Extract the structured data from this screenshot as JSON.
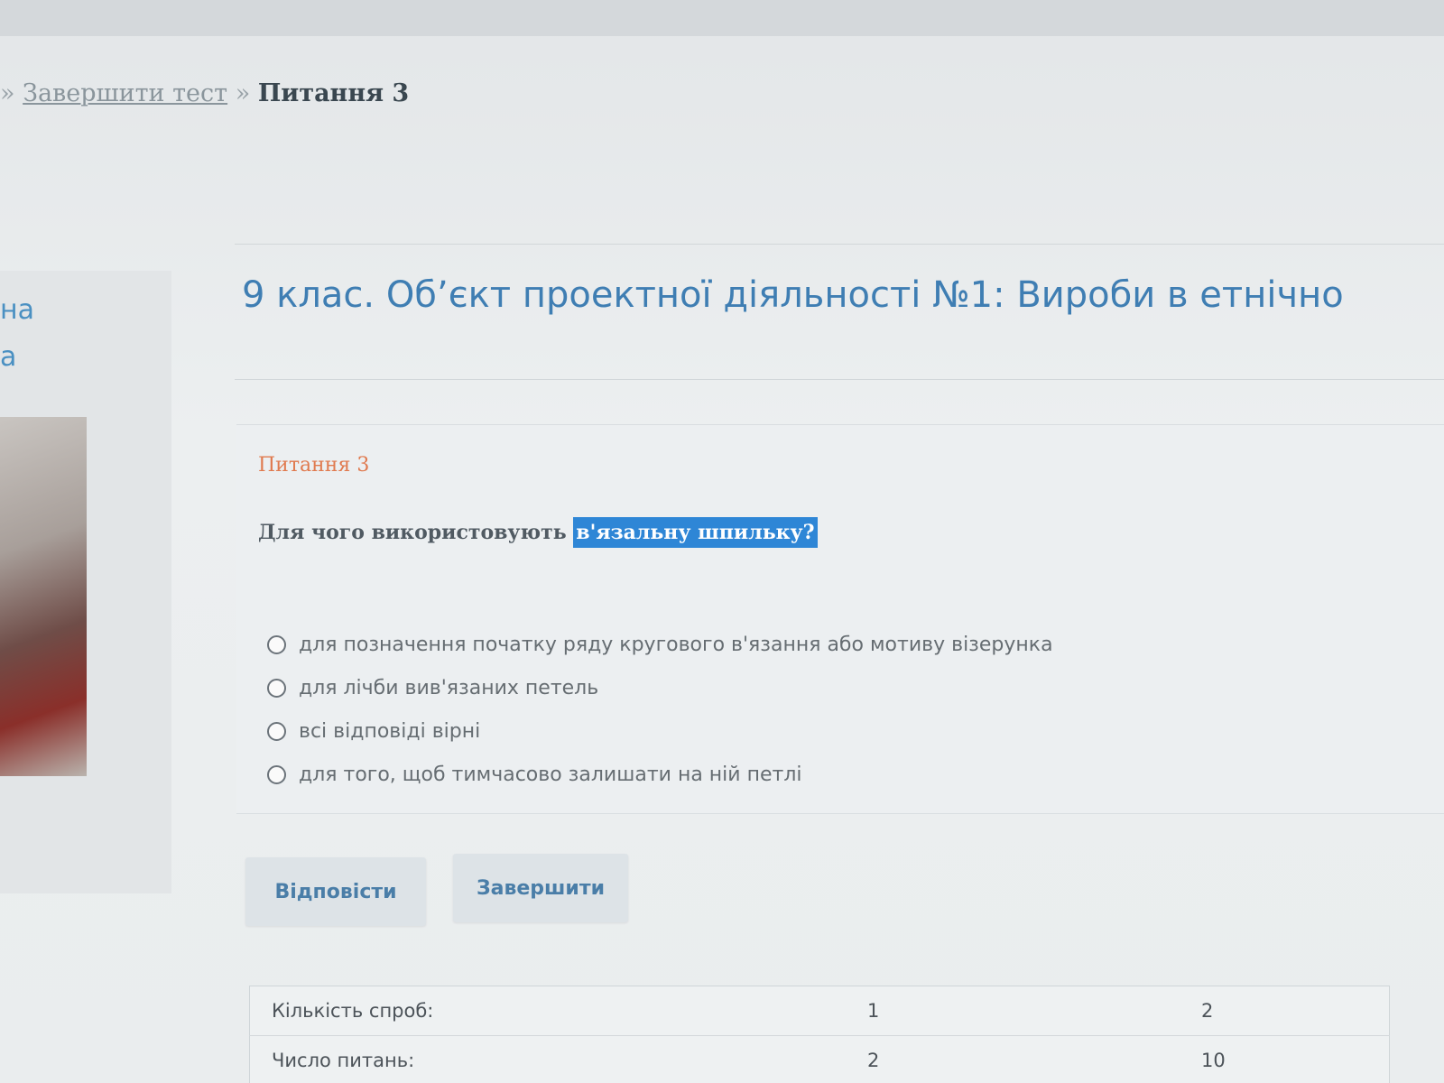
{
  "breadcrumb": {
    "separator": "»",
    "link": "Завершити тест",
    "current": "Питання 3"
  },
  "left_fragments": {
    "line1": "на",
    "line2": "а"
  },
  "page_title": "9 клас. Об’єкт проектної діяльності №1: Вироби в етнічно",
  "question": {
    "label": "Питання 3",
    "text_prefix": "Для чого використовують ",
    "text_highlighted": "в'язальну шпильку?",
    "options": [
      "для позначення початку ряду кругового в'язання або мотиву візерунка",
      "для лічби вив'язаних петель",
      "всі відповіді вірні",
      "для того, щоб тимчасово залишати на ній петлі"
    ]
  },
  "buttons": {
    "answer": "Відповісти",
    "finish": "Завершити"
  },
  "stats": {
    "rows": [
      {
        "label": "Кількість спроб:",
        "col1": "1",
        "col2": "2"
      },
      {
        "label": "Число питань:",
        "col1": "2",
        "col2": "10"
      }
    ]
  },
  "colors": {
    "title": "#3f7eb3",
    "question_label": "#e07a4f",
    "highlight_bg": "#2e86d6"
  }
}
